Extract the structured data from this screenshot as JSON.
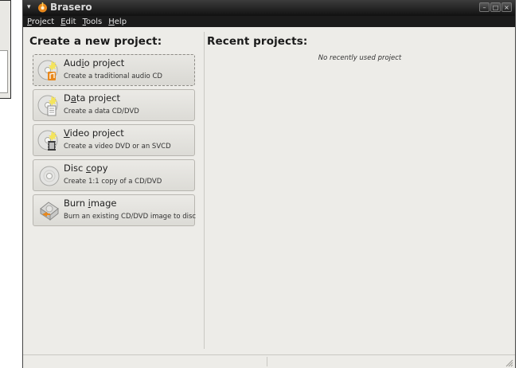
{
  "window": {
    "title": "Brasero"
  },
  "menubar": {
    "items": [
      {
        "mnemonic": "P",
        "rest": "roject"
      },
      {
        "mnemonic": "E",
        "rest": "dit"
      },
      {
        "mnemonic": "T",
        "rest": "ools"
      },
      {
        "mnemonic": "H",
        "rest": "elp"
      }
    ]
  },
  "left_panel": {
    "heading": "Create a new project:",
    "projects": [
      {
        "label_pre": "Aud",
        "label_mn": "i",
        "label_post": "o project",
        "description": "Create a traditional audio CD",
        "icon": "audio-disc-icon"
      },
      {
        "label_pre": "D",
        "label_mn": "a",
        "label_post": "ta project",
        "description": "Create a data CD/DVD",
        "icon": "data-disc-icon"
      },
      {
        "label_pre": "",
        "label_mn": "V",
        "label_post": "ideo project",
        "description": "Create a video DVD or an SVCD",
        "icon": "video-disc-icon"
      },
      {
        "label_pre": "Disc ",
        "label_mn": "c",
        "label_post": "opy",
        "description": "Create 1:1 copy of a CD/DVD",
        "icon": "disc-copy-icon"
      },
      {
        "label_pre": "Burn ",
        "label_mn": "i",
        "label_post": "mage",
        "description": "Burn an existing CD/DVD image to disc",
        "icon": "burn-image-icon"
      }
    ]
  },
  "right_panel": {
    "heading": "Recent projects:",
    "empty_message": "No recently used project"
  },
  "colors": {
    "titlebar": "#1b1b1b",
    "window_bg": "#edece8",
    "button_bg": "#dcdbd6",
    "accent_orange": "#e8881c"
  }
}
